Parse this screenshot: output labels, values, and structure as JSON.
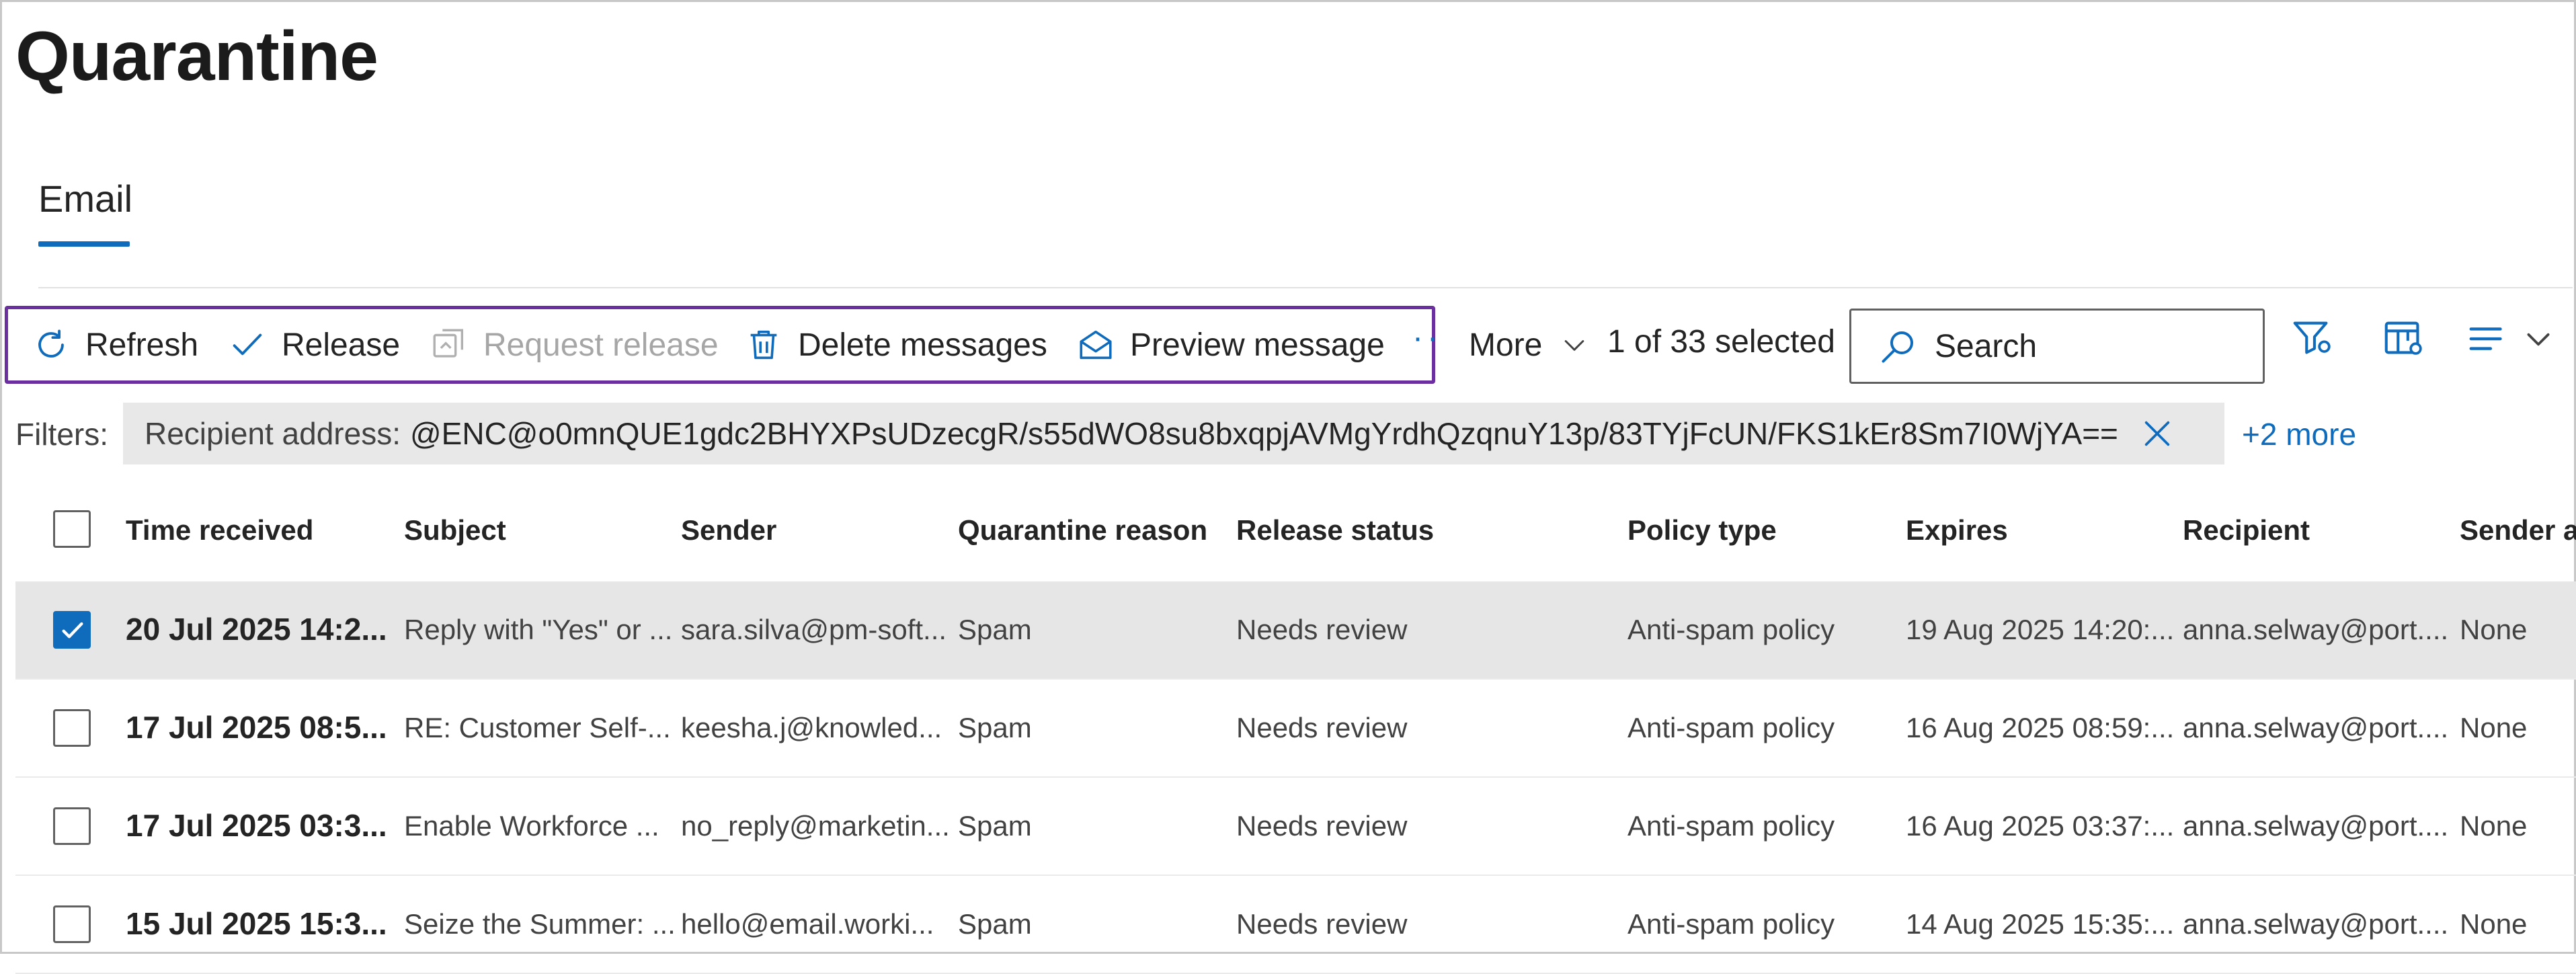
{
  "page": {
    "title": "Quarantine"
  },
  "tabs": [
    {
      "label": "Email",
      "active": true
    }
  ],
  "toolbar": {
    "refresh": "Refresh",
    "release": "Release",
    "request_release": "Request release",
    "delete_messages": "Delete messages",
    "preview_message": "Preview message",
    "more": "More",
    "selected_count": "1 of 33 selected",
    "search_placeholder": "Search",
    "icons": [
      "refresh-icon",
      "checkmark-icon",
      "request-release-icon",
      "trash-icon",
      "envelope-open-icon",
      "filter-icon",
      "customize-columns-icon",
      "group-by-icon"
    ]
  },
  "filters": {
    "label": "Filters:",
    "chip_key": "Recipient address:",
    "chip_value": "@ENC@o0mnQUE1gdc2BHYXPsUDzecgR/s55dWO8su8bxqpjAVMgYrdhQzqnuY13p/83TYjFcUN/FKS1kEr8Sm7I0WjYA==",
    "more": "+2 more"
  },
  "table": {
    "columns": [
      "Time received",
      "Subject",
      "Sender",
      "Quarantine reason",
      "Release status",
      "Policy type",
      "Expires",
      "Recipient",
      "Sender ad"
    ],
    "rows": [
      {
        "selected": true,
        "time": "20 Jul 2025 14:2...",
        "subject": "Reply with \"Yes\" or ...",
        "sender": "sara.silva@pm-soft...",
        "reason": "Spam",
        "status": "Needs review",
        "policy": "Anti-spam policy",
        "expires": "19 Aug 2025 14:20:...",
        "recipient": "anna.selway@port....",
        "sender_ad": "None"
      },
      {
        "selected": false,
        "time": "17 Jul 2025 08:5...",
        "subject": "RE: Customer Self-...",
        "sender": "keesha.j@knowled...",
        "reason": "Spam",
        "status": "Needs review",
        "policy": "Anti-spam policy",
        "expires": "16 Aug 2025 08:59:...",
        "recipient": "anna.selway@port....",
        "sender_ad": "None"
      },
      {
        "selected": false,
        "time": "17 Jul 2025 03:3...",
        "subject": "Enable Workforce ...",
        "sender": "no_reply@marketin...",
        "reason": "Spam",
        "status": "Needs review",
        "policy": "Anti-spam policy",
        "expires": "16 Aug 2025 03:37:...",
        "recipient": "anna.selway@port....",
        "sender_ad": "None"
      },
      {
        "selected": false,
        "time": "15 Jul 2025 15:3...",
        "subject": "Seize the Summer: ...",
        "sender": "hello@email.worki...",
        "reason": "Spam",
        "status": "Needs review",
        "policy": "Anti-spam policy",
        "expires": "14 Aug 2025 15:35:...",
        "recipient": "anna.selway@port....",
        "sender_ad": "None"
      }
    ]
  },
  "colors": {
    "accent": "#0f6cbd",
    "highlight_border": "#6b2fa0",
    "selected_row": "#e6e6e6",
    "chip_bg": "#e8e8e8"
  }
}
